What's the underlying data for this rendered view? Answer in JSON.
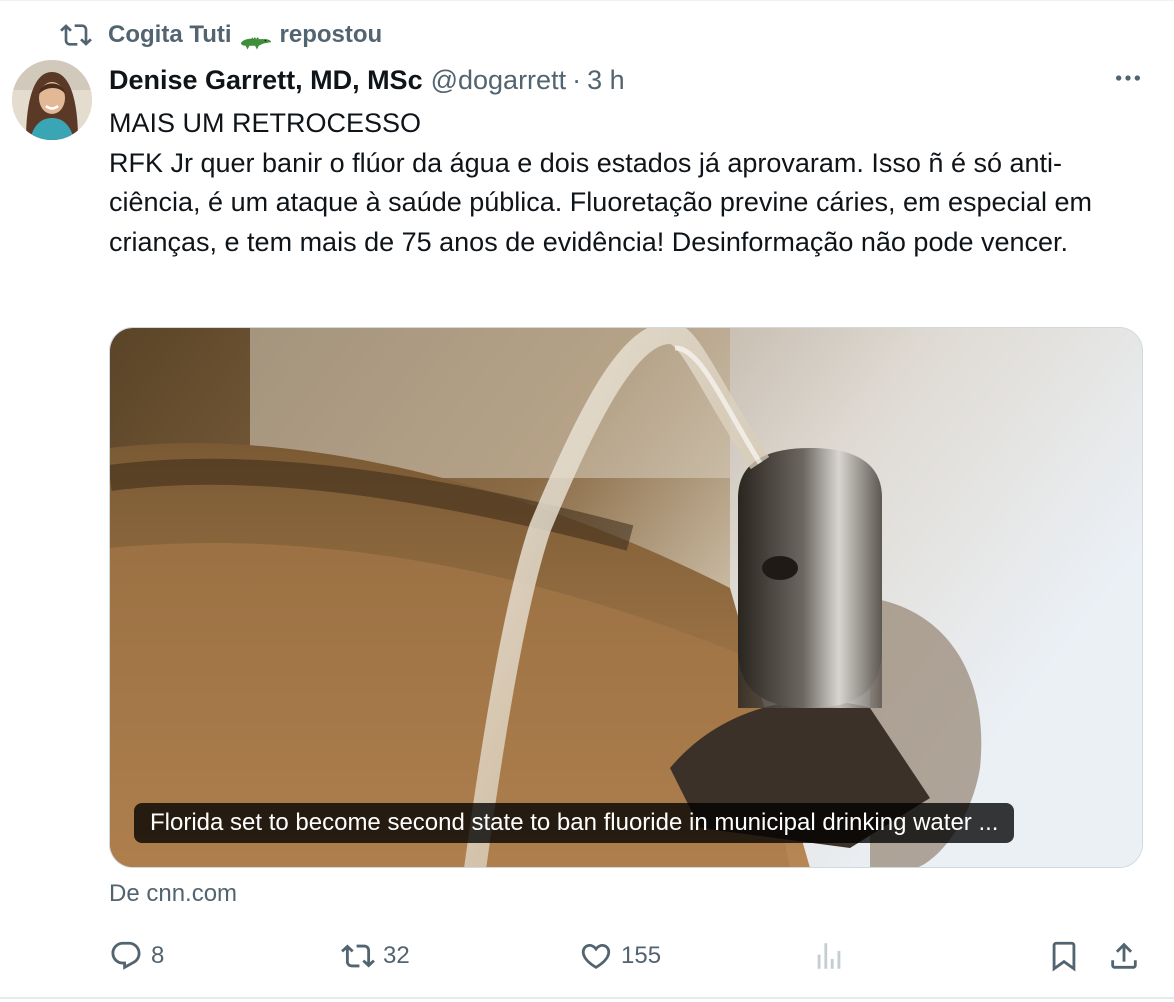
{
  "repost": {
    "icon": "repost-icon",
    "user": "Cogita Tuti",
    "emoji": "crocodile-emoji",
    "label": "repostou"
  },
  "tweet": {
    "author_name": "Denise Garrett, MD, MSc",
    "handle": "@dogarrett",
    "separator": "·",
    "time": "3 h",
    "text_lines": [
      "MAIS UM RETROCESSO",
      "RFK Jr quer banir o flúor da água e dois estados já aprovaram. Isso ñ é só anti-ciência, é um ataque à saúde pública. Fluoretação previne cáries, em especial em crianças, e tem mais de 75 anos de evidência! Desinformação não pode vencer."
    ],
    "card": {
      "caption": "Florida set to become second state to ban fluoride in municipal drinking water ...",
      "source": "De cnn.com"
    },
    "metrics": {
      "replies": "8",
      "reposts": "32",
      "likes": "155"
    }
  },
  "colors": {
    "text_primary": "#0f1419",
    "text_secondary": "#536471",
    "border": "#cfd9de"
  }
}
